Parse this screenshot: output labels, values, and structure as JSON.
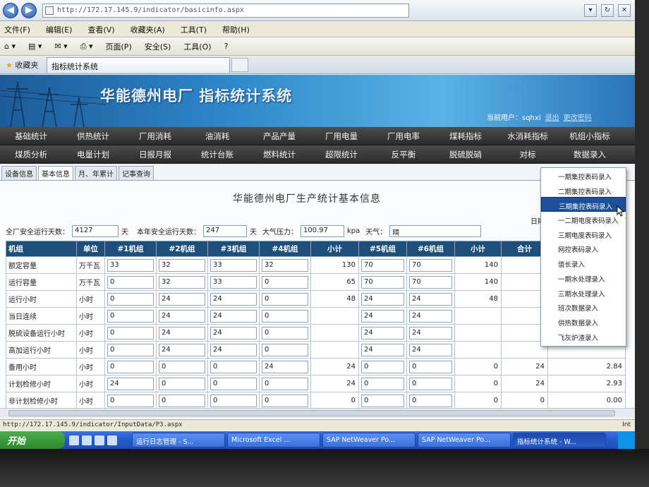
{
  "browser": {
    "url": "http://172.17.145.9/indicator/basicinfo.aspx",
    "menu": [
      "文件(F)",
      "编辑(E)",
      "查看(V)",
      "收藏夹(A)",
      "工具(T)",
      "帮助(H)"
    ],
    "commands": [
      "页面(P)",
      "安全(S)",
      "工具(O)"
    ],
    "favorites_label": "收藏夹",
    "tab_title": "指标统计系统",
    "status_url": "http://172.17.145.9/indicator/InputData/P3.aspx",
    "status_zone": "Int"
  },
  "app": {
    "title": "华能德州电厂 指标统计系统",
    "user_label": "当前用户：sqhxl",
    "logout": "退出",
    "change_password": "更改密码"
  },
  "nav_row1": [
    "基础统计",
    "供热统计",
    "厂用消耗",
    "油消耗",
    "产品产量",
    "厂用电量",
    "厂用电率",
    "煤耗指标",
    "水消耗指标",
    "机组小指标"
  ],
  "nav_row2": [
    "煤质分析",
    "电量计划",
    "日报月报",
    "统计台账",
    "燃料统计",
    "超限统计",
    "反平衡",
    "脱硫脱硝",
    "对标",
    "数据录入"
  ],
  "subtabs": [
    "设备信息",
    "基本信息",
    "月、年累计",
    "记事查询"
  ],
  "page": {
    "title": "华能德州电厂生产统计基本信息",
    "right_tag": "日期",
    "safe_days_label": "全厂安全运行天数：",
    "safe_days": "4127",
    "day_unit": "天",
    "year_safe_label": "本年安全运行天数：",
    "year_safe": "247",
    "pressure_label": "大气压力：",
    "pressure": "100.97",
    "pressure_unit": "kpa",
    "weather_label": "天气：",
    "weather": "晴"
  },
  "table": {
    "headers": [
      "机组",
      "单位",
      "#1机组",
      "#2机组",
      "#3机组",
      "#4机组",
      "小计",
      "#5机组",
      "#6机组",
      "小计",
      "合计",
      ""
    ],
    "rows": [
      {
        "label": "额定容量",
        "unit": "万千瓦",
        "u1": "33",
        "u2": "32",
        "u3": "33",
        "u4": "32",
        "sub1": "130",
        "u5": "70",
        "u6": "70",
        "sub2": "140",
        "total": "",
        "extra": ""
      },
      {
        "label": "运行容量",
        "unit": "万千瓦",
        "u1": "0",
        "u2": "32",
        "u3": "33",
        "u4": "0",
        "sub1": "65",
        "u5": "70",
        "u6": "70",
        "sub2": "140",
        "total": "",
        "extra": ""
      },
      {
        "label": "运行小时",
        "unit": "小时",
        "u1": "0",
        "u2": "24",
        "u3": "24",
        "u4": "0",
        "sub1": "48",
        "u5": "24",
        "u6": "24",
        "sub2": "48",
        "total": "",
        "extra": ""
      },
      {
        "label": "当日连续",
        "unit": "小时",
        "u1": "0",
        "u2": "24",
        "u3": "24",
        "u4": "0",
        "sub1": "",
        "u5": "24",
        "u6": "24",
        "sub2": "",
        "total": "",
        "extra": ""
      },
      {
        "label": "脱硫设备运行小时",
        "unit": "小时",
        "u1": "0",
        "u2": "24",
        "u3": "24",
        "u4": "0",
        "sub1": "",
        "u5": "24",
        "u6": "24",
        "sub2": "",
        "total": "",
        "extra": ""
      },
      {
        "label": "高加运行小时",
        "unit": "小时",
        "u1": "0",
        "u2": "24",
        "u3": "24",
        "u4": "0",
        "sub1": "",
        "u5": "24",
        "u6": "24",
        "sub2": "",
        "total": "",
        "extra": ""
      },
      {
        "label": "备用小时",
        "unit": "小时",
        "u1": "0",
        "u2": "0",
        "u3": "0",
        "u4": "24",
        "sub1": "24",
        "u5": "0",
        "u6": "0",
        "sub2": "0",
        "total": "24",
        "extra": "2.84"
      },
      {
        "label": "计划检修小时",
        "unit": "小时",
        "u1": "24",
        "u2": "0",
        "u3": "0",
        "u4": "0",
        "sub1": "24",
        "u5": "0",
        "u6": "0",
        "sub2": "0",
        "total": "24",
        "extra": "2.93"
      },
      {
        "label": "非计划检修小时",
        "unit": "小时",
        "u1": "0",
        "u2": "0",
        "u3": "0",
        "u4": "0",
        "sub1": "0",
        "u5": "0",
        "u6": "0",
        "sub2": "0",
        "total": "0",
        "extra": "0.00"
      }
    ]
  },
  "dropdown": {
    "items": [
      "一期集控表码录入",
      "二期集控表码录入",
      "三期集控表码录入",
      "一二期电度表码录入",
      "三期电度表码录入",
      "网控表码录入",
      "值长录入",
      "一期水处理录入",
      "三期水处理录入",
      "班次数据录入",
      "供热数据录入",
      "飞灰炉渣录入"
    ],
    "selected_index": 2
  },
  "taskbar": {
    "start": "开始",
    "tasks": [
      "运行日志管理 - S...",
      "Microsoft Excel ...",
      "SAP NetWeaver Po...",
      "SAP NetWeaver Po...",
      "指标统计系统 - W..."
    ],
    "active_index": 4
  },
  "colors": {
    "header_bg": "#1e4f7a",
    "nav_bg": "#2a2a2a",
    "banner": "#2e86c8",
    "selected": "#1e4f9a"
  }
}
